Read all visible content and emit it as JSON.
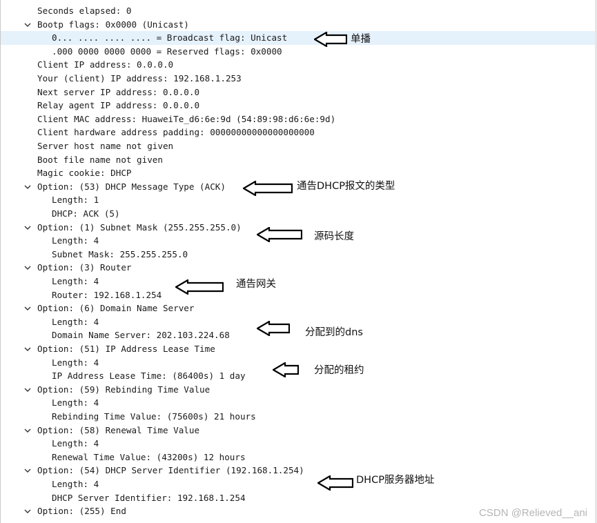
{
  "tree_rows": [
    {
      "text": "Seconds elapsed: 0",
      "level": 0,
      "expander": false
    },
    {
      "text": "Bootp flags: 0x0000 (Unicast)",
      "level": 0,
      "expander": true
    },
    {
      "text": "0... .... .... .... = Broadcast flag: Unicast",
      "level": 1,
      "expander": false,
      "selected": true
    },
    {
      "text": ".000 0000 0000 0000 = Reserved flags: 0x0000",
      "level": 1,
      "expander": false
    },
    {
      "text": "Client IP address: 0.0.0.0",
      "level": 0,
      "expander": false
    },
    {
      "text": "Your (client) IP address: 192.168.1.253",
      "level": 0,
      "expander": false
    },
    {
      "text": "Next server IP address: 0.0.0.0",
      "level": 0,
      "expander": false
    },
    {
      "text": "Relay agent IP address: 0.0.0.0",
      "level": 0,
      "expander": false
    },
    {
      "text": "Client MAC address: HuaweiTe_d6:6e:9d (54:89:98:d6:6e:9d)",
      "level": 0,
      "expander": false
    },
    {
      "text": "Client hardware address padding: 00000000000000000000",
      "level": 0,
      "expander": false
    },
    {
      "text": "Server host name not given",
      "level": 0,
      "expander": false
    },
    {
      "text": "Boot file name not given",
      "level": 0,
      "expander": false
    },
    {
      "text": "Magic cookie: DHCP",
      "level": 0,
      "expander": false
    },
    {
      "text": "Option: (53) DHCP Message Type (ACK)",
      "level": 0,
      "expander": true
    },
    {
      "text": "Length: 1",
      "level": 1,
      "expander": false
    },
    {
      "text": "DHCP: ACK (5)",
      "level": 1,
      "expander": false
    },
    {
      "text": "Option: (1) Subnet Mask (255.255.255.0)",
      "level": 0,
      "expander": true
    },
    {
      "text": "Length: 4",
      "level": 1,
      "expander": false
    },
    {
      "text": "Subnet Mask: 255.255.255.0",
      "level": 1,
      "expander": false
    },
    {
      "text": "Option: (3) Router",
      "level": 0,
      "expander": true
    },
    {
      "text": "Length: 4",
      "level": 1,
      "expander": false
    },
    {
      "text": "Router: 192.168.1.254",
      "level": 1,
      "expander": false
    },
    {
      "text": "Option: (6) Domain Name Server",
      "level": 0,
      "expander": true
    },
    {
      "text": "Length: 4",
      "level": 1,
      "expander": false
    },
    {
      "text": "Domain Name Server: 202.103.224.68",
      "level": 1,
      "expander": false
    },
    {
      "text": "Option: (51) IP Address Lease Time",
      "level": 0,
      "expander": true
    },
    {
      "text": "Length: 4",
      "level": 1,
      "expander": false
    },
    {
      "text": "IP Address Lease Time: (86400s) 1 day",
      "level": 1,
      "expander": false
    },
    {
      "text": "Option: (59) Rebinding Time Value",
      "level": 0,
      "expander": true
    },
    {
      "text": "Length: 4",
      "level": 1,
      "expander": false
    },
    {
      "text": "Rebinding Time Value: (75600s) 21 hours",
      "level": 1,
      "expander": false
    },
    {
      "text": "Option: (58) Renewal Time Value",
      "level": 0,
      "expander": true
    },
    {
      "text": "Length: 4",
      "level": 1,
      "expander": false
    },
    {
      "text": "Renewal Time Value: (43200s) 12 hours",
      "level": 1,
      "expander": false
    },
    {
      "text": "Option: (54) DHCP Server Identifier (192.168.1.254)",
      "level": 0,
      "expander": true
    },
    {
      "text": "Length: 4",
      "level": 1,
      "expander": false
    },
    {
      "text": "DHCP Server Identifier: 192.168.1.254",
      "level": 1,
      "expander": false
    },
    {
      "text": "Option: (255) End",
      "level": 0,
      "expander": true
    }
  ],
  "annotations": [
    {
      "label": "单播",
      "row": 2
    },
    {
      "label": "通告DHCP报文的类型",
      "row": 13
    },
    {
      "label": "源码长度",
      "row": 16
    },
    {
      "label": "通告网关",
      "row": 21
    },
    {
      "label": "分配到的dns",
      "row": 24
    },
    {
      "label": "分配的租约",
      "row": 27
    },
    {
      "label": "DHCP服务器地址",
      "row": 34
    }
  ],
  "icons": {
    "expander": "chevron-down-icon",
    "pointer": "arrow-left-icon"
  },
  "colors": {
    "selection": "#e5f1fb",
    "text": "#1a1a1a"
  },
  "watermark": "CSDN @Relieved__ani"
}
